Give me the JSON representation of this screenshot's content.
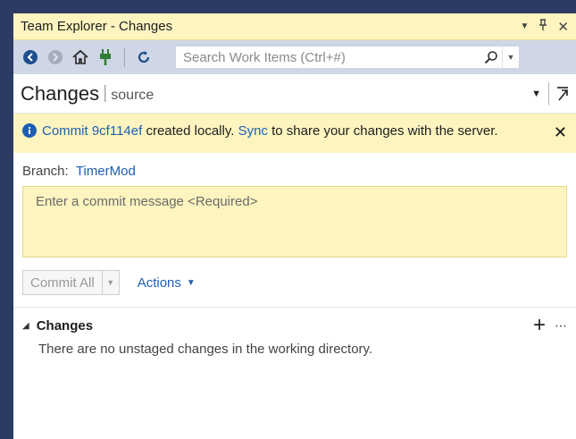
{
  "window": {
    "title": "Team Explorer - Changes"
  },
  "search": {
    "placeholder": "Search Work Items (Ctrl+#)"
  },
  "header": {
    "title": "Changes",
    "separator": "|",
    "subtitle": "source"
  },
  "notice": {
    "prefix": "Commit",
    "commit_id": "9cf114ef",
    "middle": "created locally.",
    "sync_link": "Sync",
    "suffix": "to share your changes with the server."
  },
  "branch": {
    "label": "Branch:",
    "name": "TimerMod"
  },
  "commit": {
    "placeholder": "Enter a commit message <Required>",
    "value": ""
  },
  "buttons": {
    "commit_all": "Commit All",
    "actions": "Actions"
  },
  "changes": {
    "heading": "Changes",
    "empty_message": "There are no unstaged changes in the working directory."
  },
  "colors": {
    "accent": "#1e5fb4",
    "notice_bg": "#fdf4bf",
    "toolbar_bg": "#cfd6e5",
    "frame": "#2b3b63"
  }
}
